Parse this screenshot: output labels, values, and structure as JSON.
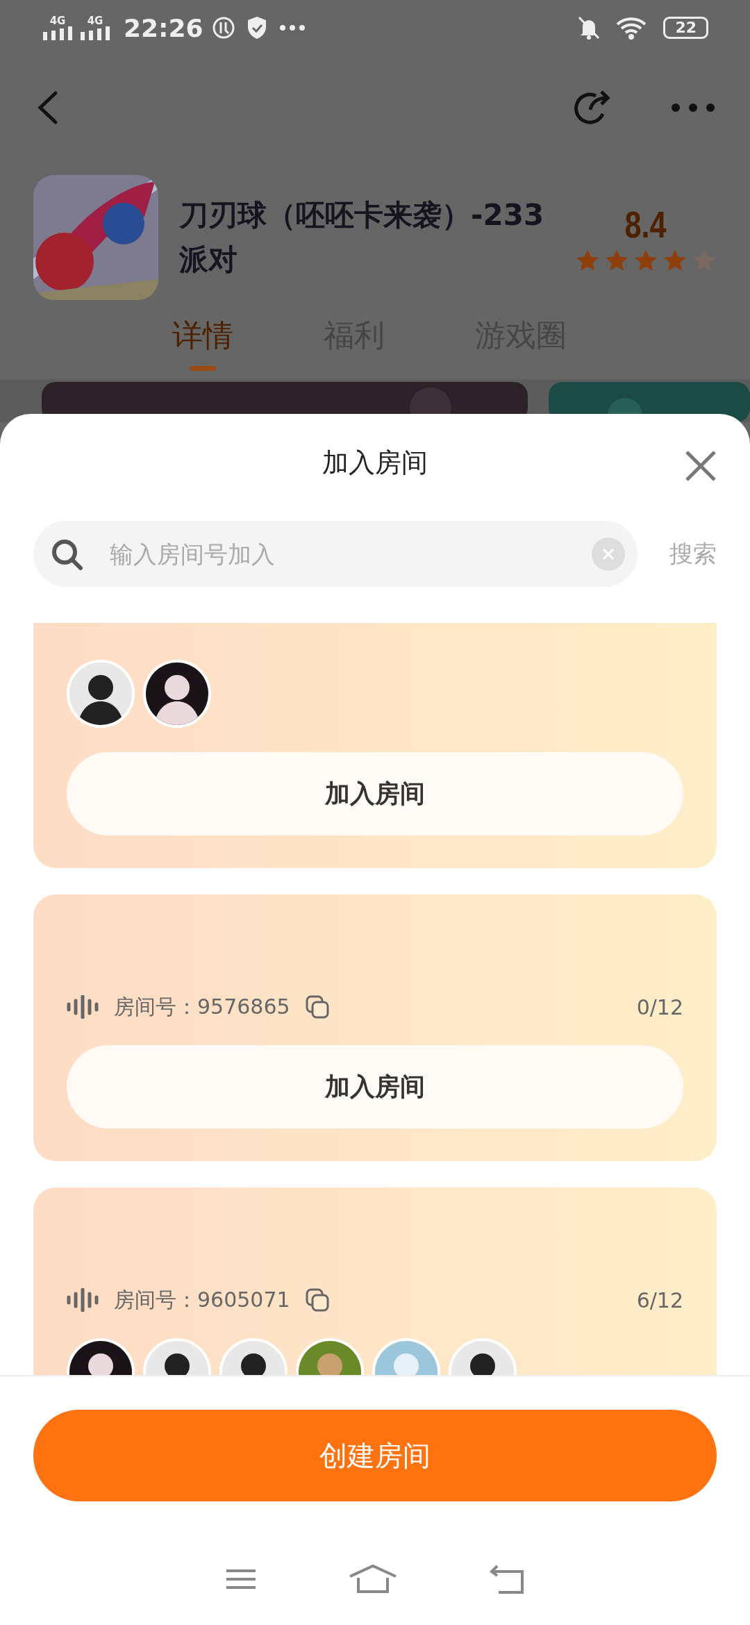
{
  "status_bar": {
    "time": "22:26",
    "battery": "22",
    "networks": [
      "4G",
      "4G"
    ]
  },
  "game": {
    "title": "刀刃球（呸呸卡来袭）-233派对",
    "rating": "8.4",
    "stars": 4
  },
  "tabs": [
    {
      "label": "详情",
      "selected": true
    },
    {
      "label": "福利",
      "selected": false
    },
    {
      "label": "游戏圈",
      "selected": false
    }
  ],
  "sheet": {
    "title": "加入房间",
    "search": {
      "placeholder": "输入房间号加入",
      "button": "搜索"
    },
    "rooms": [
      {
        "avatars": [
          {
            "kind": "light"
          },
          {
            "kind": "dark"
          }
        ],
        "button": "加入房间"
      },
      {
        "room": "房间号：9576865",
        "occupancy": "0/12",
        "button": "加入房间"
      },
      {
        "room": "房间号：9605071",
        "occupancy": "6/12",
        "avatars": [
          {
            "kind": "dark"
          },
          {
            "kind": "light"
          },
          {
            "kind": "light"
          },
          {
            "kind": "green"
          },
          {
            "kind": "blue"
          },
          {
            "kind": "light"
          }
        ]
      }
    ],
    "create_button": "创建房间"
  }
}
